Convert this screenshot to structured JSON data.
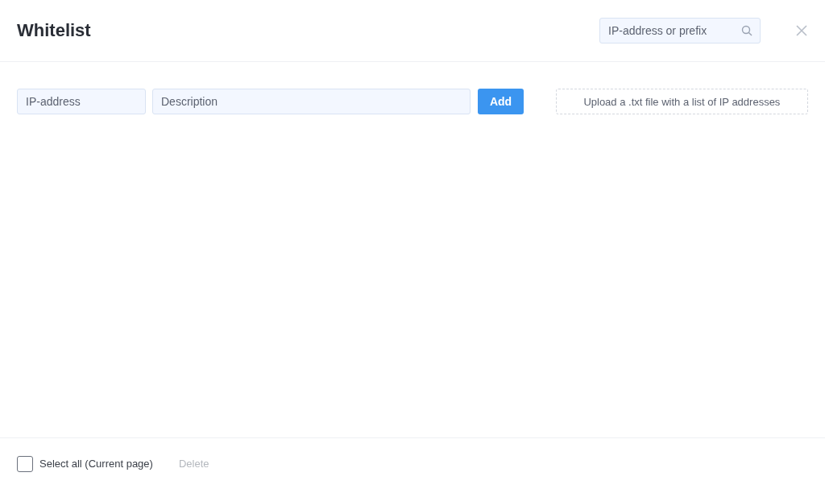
{
  "header": {
    "title": "Whitelist",
    "search": {
      "placeholder": "IP-address or prefix"
    }
  },
  "form": {
    "ip_field": {
      "placeholder": "IP-address"
    },
    "description_field": {
      "placeholder": "Description"
    },
    "add_button": "Add",
    "upload": "Upload a .txt file with a list of IP addresses"
  },
  "footer": {
    "select_all": {
      "label": "Select all (Current page)",
      "checked": false
    },
    "delete_button": {
      "label": "Delete",
      "disabled": true
    }
  }
}
